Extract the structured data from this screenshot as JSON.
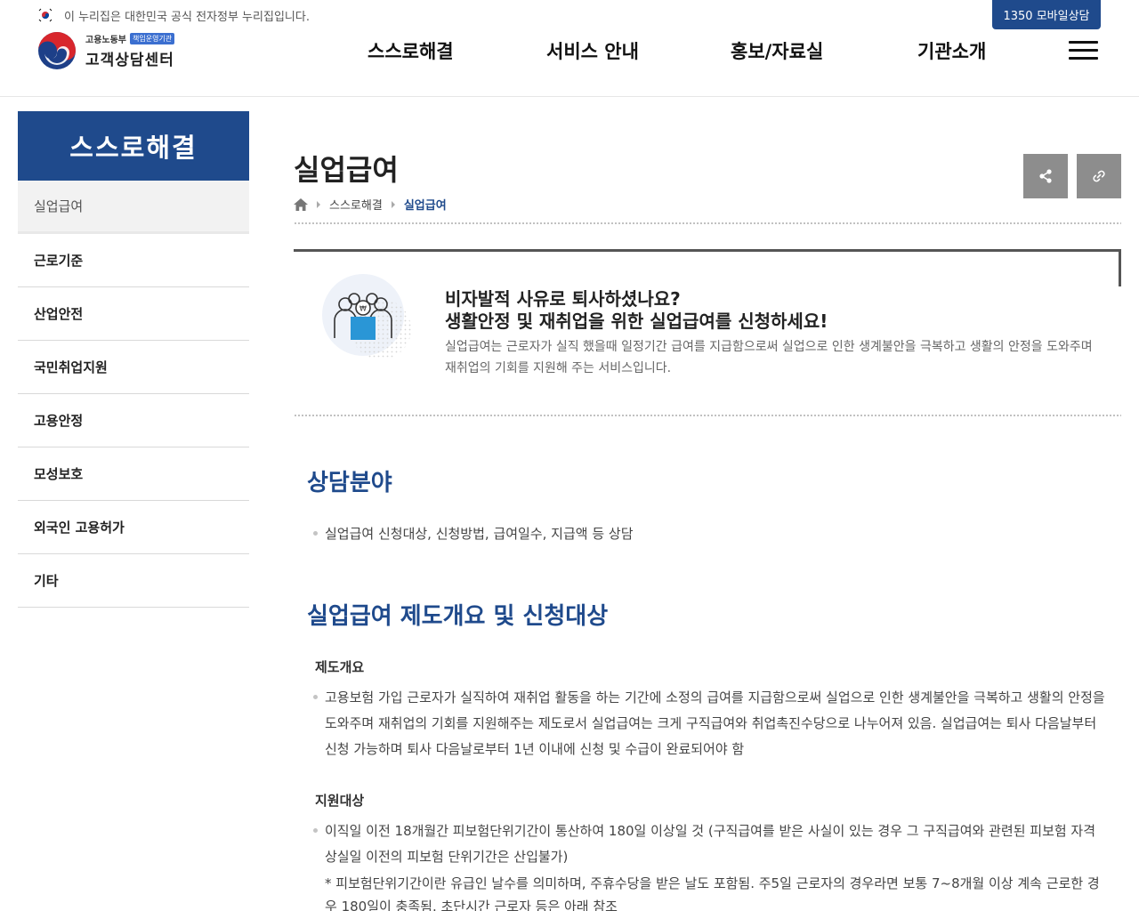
{
  "header": {
    "gov_notice": "이 누리집은 대한민국 공식 전자정부 누리집입니다.",
    "mobile_button": "1350 모바일상담",
    "logo": {
      "ministry": "고용노동부",
      "tag": "책임운영기관",
      "center": "고객상담센터"
    },
    "nav": [
      "스스로해결",
      "서비스 안내",
      "홍보/자료실",
      "기관소개"
    ],
    "menu_icon": "hamburger-icon"
  },
  "sidebar": {
    "title": "스스로해결",
    "items": [
      "실업급여",
      "근로기준",
      "산업안전",
      "국민취업지원",
      "고용안정",
      "모성보호",
      "외국인 고용허가",
      "기타"
    ],
    "active_index": 0
  },
  "page": {
    "title": "실업급여",
    "breadcrumb": [
      "스스로해결",
      "실업급여"
    ],
    "share_icon": "share-icon",
    "link_icon": "link-icon"
  },
  "intro": {
    "question1": "비자발적 사유로 퇴사하셨나요?",
    "question2": "생활안정 및 재취업을 위한 실업급여를 신청하세요!",
    "description": "실업급여는 근로자가 실직 했을때 일정기간 급여를 지급함으로써 실업으로 인한 생계불안을 극복하고 생활의 안정을 도와주며 재취업의 기회를 지원해 주는 서비스입니다."
  },
  "sections": {
    "consult": {
      "title": "상담분야",
      "item": "실업급여 신청대상, 신청방법, 급여일수, 지급액 등 상담"
    },
    "overview": {
      "title": "실업급여 제도개요 및 신청대상",
      "system_title": "제도개요",
      "system_text": "고용보험 가입 근로자가 실직하여 재취업 활동을 하는 기간에 소정의 급여를 지급함으로써 실업으로 인한 생계불안을 극복하고 생활의 안정을 도와주며 재취업의 기회를 지원해주는 제도로서 실업급여는 크게 구직급여와 취업촉진수당으로 나누어져 있음. 실업급여는 퇴사 다음날부터 신청 가능하며 퇴사 다음날로부터 1년 이내에 신청 및 수급이 완료되어야 함",
      "target_title": "지원대상",
      "target_text": "이직일 이전 18개월간 피보험단위기간이 통산하여 180일 이상일 것 (구직급여를 받은 사실이 있는 경우 그 구직급여와 관련된 피보험 자격 상실일 이전의 피보험 단위기간은 산입불가)",
      "target_note": "* 피보험단위기간이란 유급인 날수를 의미하며, 주휴수당을 받은 날도 포함됨. 주5일 근로자의 경우라면 보통 7~8개월 이상 계속 근로한 경우 180일이 충족됨. 초단시간 근로자 등은 아래 참조"
    }
  },
  "colors": {
    "primary": "#1f4a8c",
    "button_gray": "#8d8d8d"
  }
}
